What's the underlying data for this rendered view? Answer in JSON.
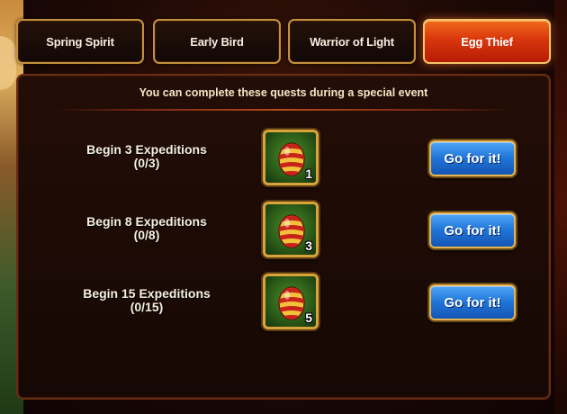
{
  "tabs": [
    {
      "label": "Spring Spirit",
      "active": false
    },
    {
      "label": "Early Bird",
      "active": false
    },
    {
      "label": "Warrior of Light",
      "active": false
    },
    {
      "label": "Egg Thief",
      "active": true
    }
  ],
  "notice": "You can complete these quests during a special event",
  "quests": [
    {
      "title": "Begin 3 Expeditions",
      "progress": "(0/3)",
      "reward_icon": "striped-egg-icon",
      "reward_qty": "1",
      "button": "Go for it!"
    },
    {
      "title": "Begin 8 Expeditions",
      "progress": "(0/8)",
      "reward_icon": "striped-egg-icon",
      "reward_qty": "3",
      "button": "Go for it!"
    },
    {
      "title": "Begin 15 Expeditions",
      "progress": "(0/15)",
      "reward_icon": "striped-egg-icon",
      "reward_qty": "5",
      "button": "Go for it!"
    }
  ],
  "colors": {
    "active_tab": "#d9360c",
    "tab_border": "#c4923c",
    "button_blue": "#1f74d8",
    "panel_bg": "#1b0a05"
  }
}
